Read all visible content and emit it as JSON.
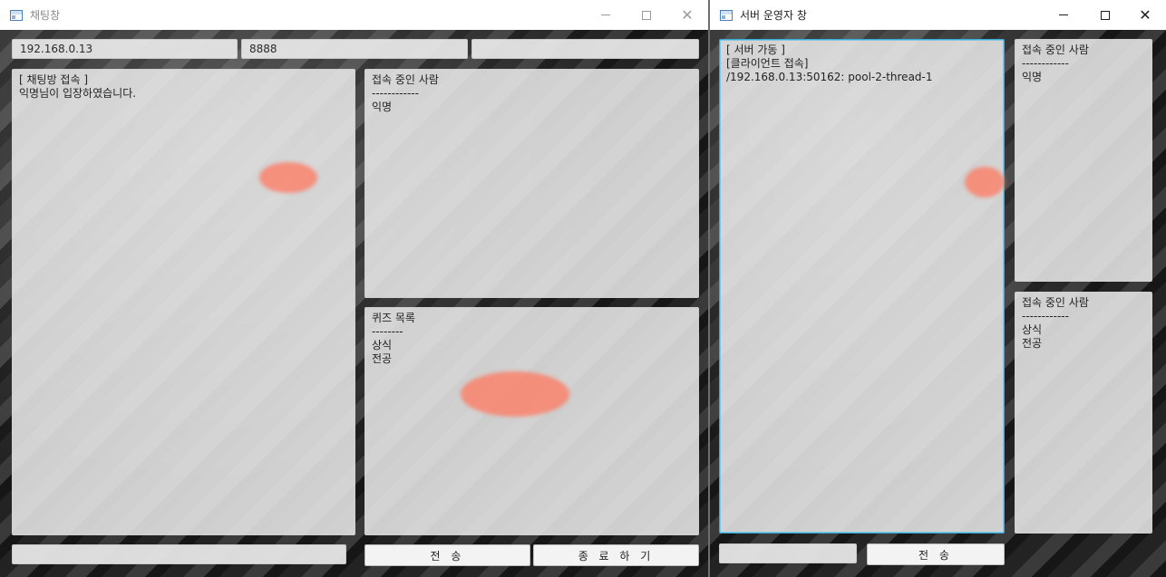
{
  "chat_window": {
    "title": "채팅창",
    "ip_value": "192.168.0.13",
    "port_value": "8888",
    "name_value": "",
    "chat_log": [
      "[ 채팅방 접속 ]",
      "익명님이 입장하였습니다."
    ],
    "users_panel": [
      "접속 중인 사람",
      "------------",
      "익명"
    ],
    "quiz_panel": [
      "퀴즈 목록",
      "--------",
      "상식",
      "전공"
    ],
    "message_value": "",
    "send_label": "전 송",
    "exit_label": "종 료 하 기"
  },
  "server_window": {
    "title": "서버 운영자 창",
    "log": [
      "[ 서버 가동 ]",
      "[클라이언트 접속]",
      "/192.168.0.13:50162: pool-2-thread-1"
    ],
    "users_panel": [
      "접속 중인 사람",
      "------------",
      "익명"
    ],
    "users_panel_2": [
      "접속 중인 사람",
      "------------",
      "상식",
      "전공"
    ],
    "message_value": "",
    "send_label": "전 송"
  },
  "icons": {
    "app": "window-app-icon",
    "minimize": "minimize-icon",
    "maximize": "maximize-icon",
    "close": "close-icon"
  },
  "colors": {
    "focus_border": "#3fa9d4",
    "accent_decoration": "#ff785f"
  }
}
